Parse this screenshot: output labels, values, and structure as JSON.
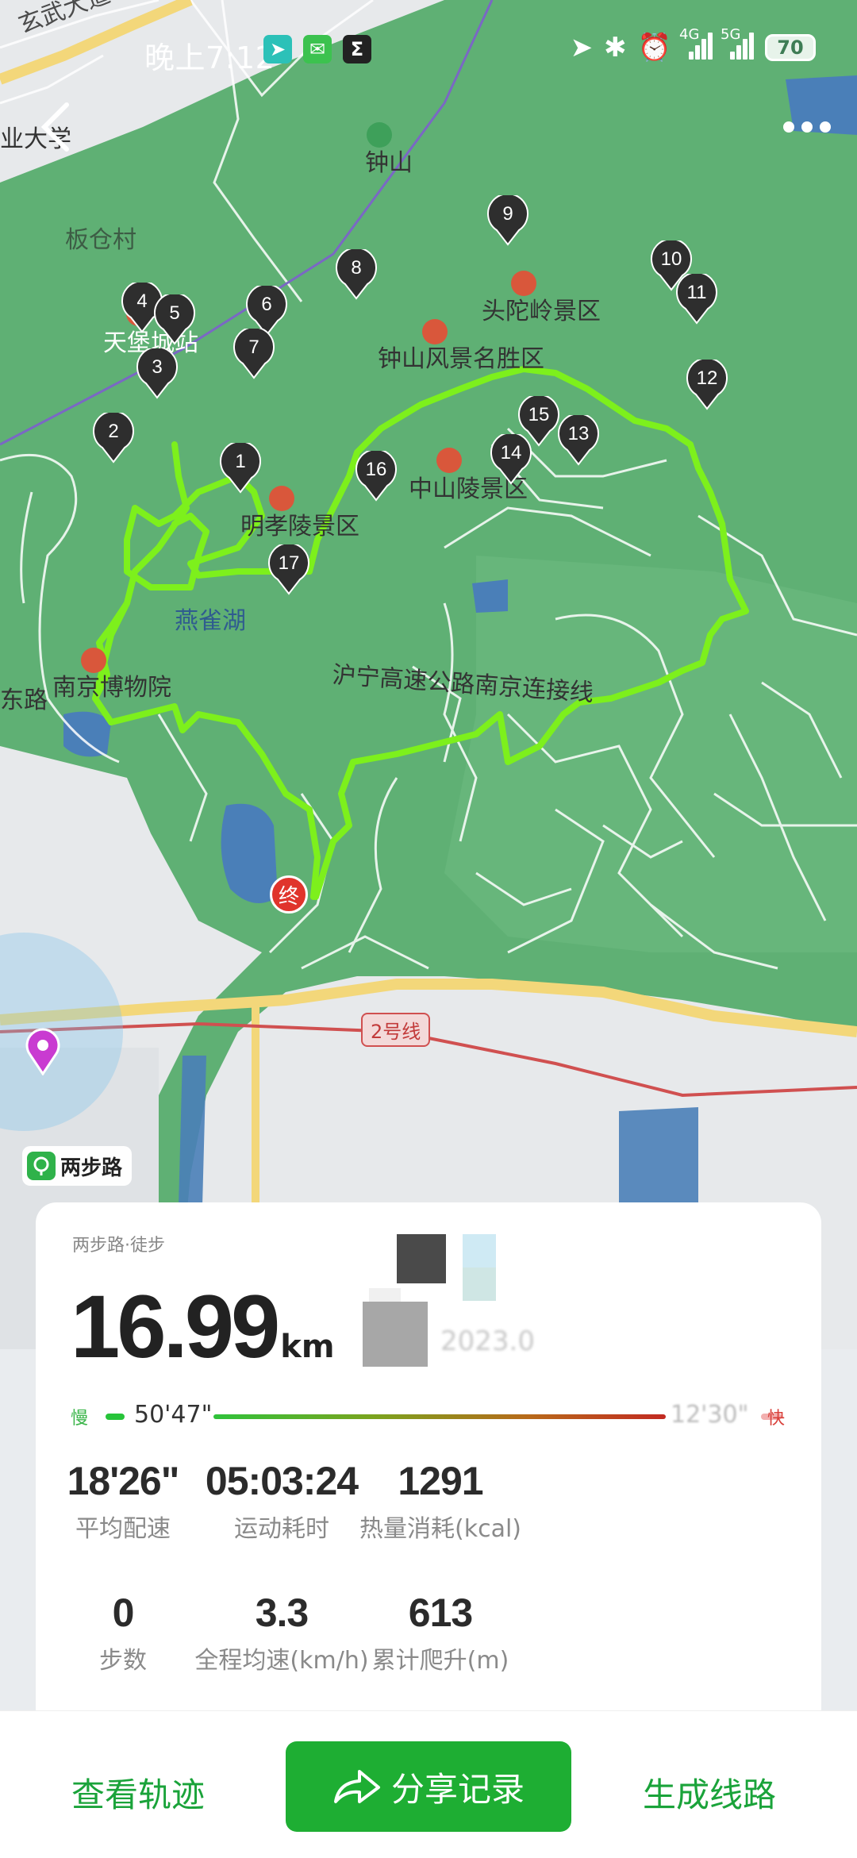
{
  "status_bar": {
    "time": "晚上7:12",
    "net1": "4G",
    "net2": "5G",
    "battery": "70"
  },
  "map": {
    "labels": {
      "road_top": "玄武大道",
      "university": "业大学",
      "mountain": "钟山",
      "village": "板仓村",
      "station": "天堡城站",
      "scenic_area": "钟山风景名胜区",
      "toutuoling": "头陀岭景区",
      "zhongshanling": "中山陵景区",
      "mingxiaoling": "明孝陵景区",
      "lake": "燕雀湖",
      "museum": "南京博物院",
      "metro": "2号线",
      "highway": "沪宁高速公路南京连接线",
      "road_left": "东路",
      "end_marker": "终"
    },
    "markers": [
      "1",
      "2",
      "3",
      "4",
      "5",
      "6",
      "7",
      "8",
      "9",
      "10",
      "11",
      "12",
      "13",
      "14",
      "15",
      "16",
      "17"
    ],
    "route_color": "#7df01c",
    "park_color": "#5fb074"
  },
  "badge": {
    "text": "两步路"
  },
  "card": {
    "app_line": "两步路·徒步",
    "distance": "16.99",
    "distance_unit": "km",
    "date_blurred": "2023.0",
    "pace": {
      "slow_label": "慢",
      "fast_label": "快",
      "min": "50'47\"",
      "max": "12'30\""
    },
    "stats": [
      {
        "value": "18'26\"",
        "label": "平均配速"
      },
      {
        "value": "05:03:24",
        "label": "运动耗时"
      },
      {
        "value": "1291",
        "label": "热量消耗(kcal)"
      },
      {
        "value": "0",
        "label": "步数"
      },
      {
        "value": "3.3",
        "label": "全程均速(km/h)"
      },
      {
        "value": "613",
        "label": "累计爬升(m)"
      }
    ]
  },
  "bottom": {
    "view_track": "查看轨迹",
    "share": "分享记录",
    "gen_route": "生成线路"
  }
}
